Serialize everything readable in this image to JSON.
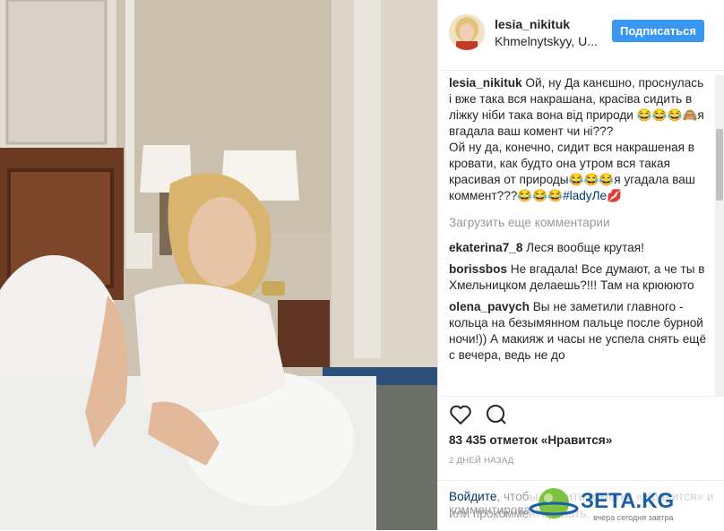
{
  "post": {
    "username": "lesia_nikituk",
    "location": "Khmelnytskyy, U...",
    "follow_label": "Подписаться"
  },
  "caption": {
    "username": "lesia_nikituk",
    "text_ua": "Ой, ну Да канєшно, проснулась і вже така вся накрашана, красіва сидить в ліжку ніби така вона від природи 😂😂😂🙈я вгадала ваш комент чи ні???",
    "text_ru": "Ой ну да, конечно, сидит вся накрашеная в кровати, как будто она утром вся такая красивая от природы😂😂😂я угадала ваш коммент???😂😂😂",
    "hashtag": "#ladyЛе",
    "emoji_end": "💋"
  },
  "load_more": "Загрузить еще комментарии",
  "comments": [
    {
      "user": "ekaterina7_8",
      "text": "Леся вообще крутая!"
    },
    {
      "user": "borissbos",
      "text": "Не вгадала! Все думают, а че ты в Хмельницком делаешь?!!! Там на крюююто"
    },
    {
      "user": "olena_pavych",
      "text": "Вы не заметили главного - кольца на безымянном пальце после бурной ночи!)) А макияж и часы не успела снять ещё с вечера, ведь не до"
    }
  ],
  "likes": "83 435 отметок «Нравится»",
  "time": "2 ДНЕЙ НАЗАД",
  "footer": {
    "login": "Войдите",
    "rest1": ", чтобы ставить отметки «Нравится» и комментировать",
    "line2": "или прокомментировать."
  },
  "watermark": {
    "brand": "ЗЕТА.KG",
    "tagline": "вчера сегодня завтра"
  },
  "icons": [
    "heart-icon",
    "comment-icon",
    "globe-logo-icon"
  ],
  "colors": {
    "accent": "#3897f0",
    "link": "#003569",
    "muted": "#999999",
    "brand_green": "#7cc240"
  }
}
